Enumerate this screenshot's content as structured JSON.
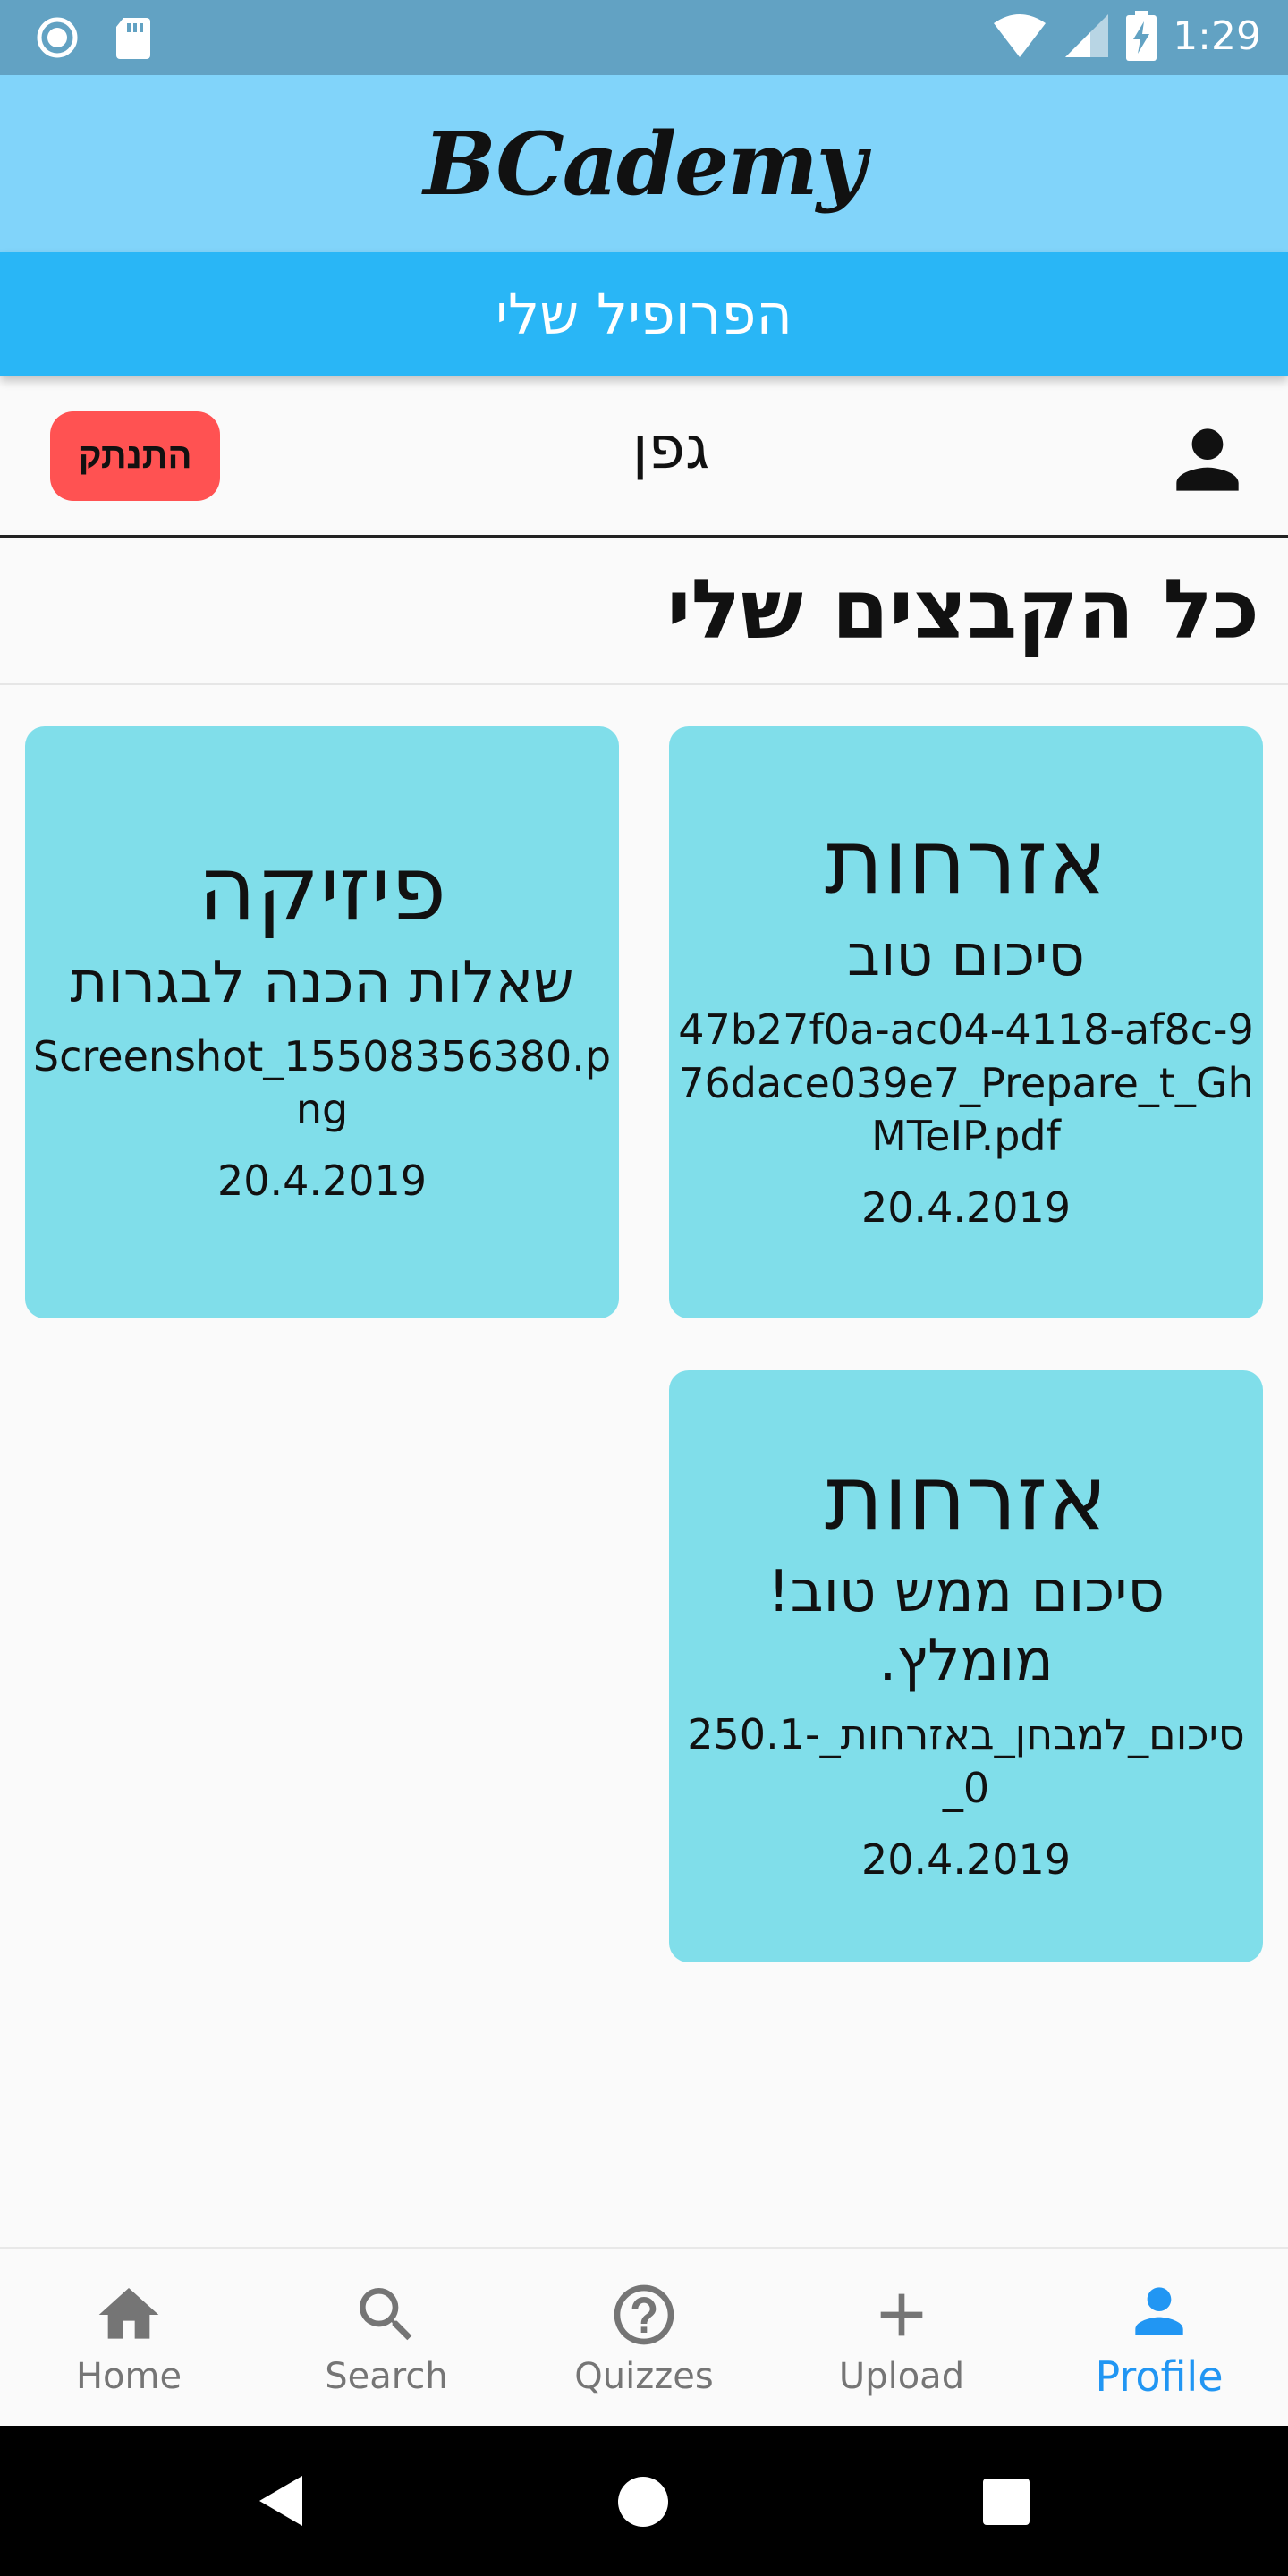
{
  "status_bar": {
    "time": "1:29"
  },
  "app_bar": {
    "title": "BCademy"
  },
  "header": {
    "title": "הפרופיל שלי"
  },
  "profile": {
    "username": "גפן",
    "logout_label": "התנתק"
  },
  "section": {
    "title": "כל הקבצים שלי"
  },
  "cards": [
    {
      "subject": "אזרחות",
      "description": "סיכום טוב",
      "file": "47b27f0a-ac04-4118-af8c-976dace039e7_Prepare_t_GhMTeIP.pdf",
      "date": "20.4.2019"
    },
    {
      "subject": "פיזיקה",
      "description": "שאלות הכנה לבגרות",
      "file": "Screenshot_15508356380.png",
      "date": "20.4.2019"
    },
    {
      "subject": "אזרחות",
      "description": "סיכום ממש טוב! מומלץ.",
      "file": "סיכום_למבחן_באזרחות_-250.10_",
      "date": "20.4.2019"
    }
  ],
  "bottom_nav": {
    "items": [
      {
        "label": "Home",
        "icon": "home-icon"
      },
      {
        "label": "Search",
        "icon": "search-icon"
      },
      {
        "label": "Quizzes",
        "icon": "help-circle-icon"
      },
      {
        "label": "Upload",
        "icon": "plus-icon"
      },
      {
        "label": "Profile",
        "icon": "person-icon",
        "active": true
      }
    ]
  },
  "colors": {
    "status_bar": "#62a2c3",
    "app_bar": "#81d4fa",
    "header": "#29b6f6",
    "card": "#80deea",
    "logout": "#ff5252",
    "nav_active": "#2196f3",
    "nav_inactive": "#757575"
  }
}
